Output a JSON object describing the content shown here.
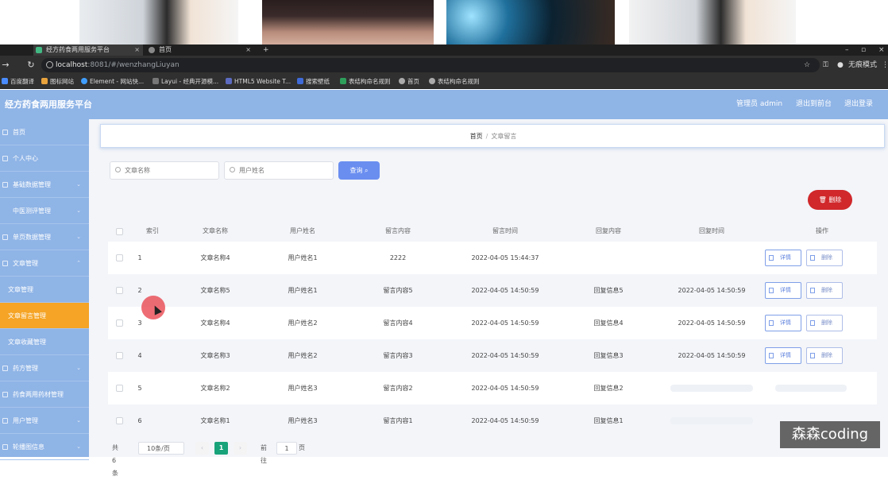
{
  "browser": {
    "tabs": [
      {
        "title": "经方药食两用服务平台",
        "active": true
      },
      {
        "title": "首页",
        "active": false
      }
    ],
    "url_host": "localhost",
    "url_rest": ":8081/#/wenzhangLiuyan",
    "profile_label": "无痕模式",
    "bookmarks": [
      "百度翻译",
      "图标网站",
      "Element - 网站快...",
      "Layui - 经典开源模...",
      "HTML5 Website T...",
      "搜索壁纸",
      "表结构命名规则",
      "首页",
      "表结构命名规则"
    ]
  },
  "header": {
    "title": "经方药食两用服务平台",
    "user_label": "管理员 admin",
    "back_label": "退出到前台",
    "logout_label": "退出登录"
  },
  "sidebar": {
    "items": [
      {
        "label": "首页"
      },
      {
        "label": "个人中心"
      },
      {
        "label": "基础数据管理"
      },
      {
        "label": "中医测评管理"
      },
      {
        "label": "单页数据管理"
      },
      {
        "label": "文章管理"
      },
      {
        "label": "文章管理"
      },
      {
        "label": "文章留言管理"
      },
      {
        "label": "文章收藏管理"
      },
      {
        "label": "药方管理"
      },
      {
        "label": "药食两用药材管理"
      },
      {
        "label": "用户管理"
      },
      {
        "label": "轮播图信息"
      }
    ]
  },
  "breadcrumb": {
    "home": "首页",
    "sep": "/",
    "current": "文章留言"
  },
  "search": {
    "title_placeholder": "文章名称",
    "user_placeholder": "用户姓名",
    "query_label": "查询"
  },
  "toolbar": {
    "delete_label": "删除"
  },
  "table": {
    "columns": [
      "索引",
      "文章名称",
      "用户姓名",
      "留言内容",
      "留言时间",
      "回复内容",
      "回复时间",
      "操作"
    ],
    "detail_label": "详情",
    "delete_label": "删除",
    "rows": [
      {
        "index": "1",
        "title": "文章名称4",
        "user": "用户姓名1",
        "content": "2222",
        "time": "2022-04-05 15:44:37",
        "reply": "",
        "reply_time": ""
      },
      {
        "index": "2",
        "title": "文章名称5",
        "user": "用户姓名1",
        "content": "留言内容5",
        "time": "2022-04-05 14:50:59",
        "reply": "回复信息5",
        "reply_time": "2022-04-05 14:50:59"
      },
      {
        "index": "3",
        "title": "文章名称4",
        "user": "用户姓名2",
        "content": "留言内容4",
        "time": "2022-04-05 14:50:59",
        "reply": "回复信息4",
        "reply_time": "2022-04-05 14:50:59"
      },
      {
        "index": "4",
        "title": "文章名称3",
        "user": "用户姓名2",
        "content": "留言内容3",
        "time": "2022-04-05 14:50:59",
        "reply": "回复信息3",
        "reply_time": "2022-04-05 14:50:59"
      },
      {
        "index": "5",
        "title": "文章名称2",
        "user": "用户姓名3",
        "content": "留言内容2",
        "time": "2022-04-05 14:50:59",
        "reply": "回复信息2",
        "reply_time": ""
      },
      {
        "index": "6",
        "title": "文章名称1",
        "user": "用户姓名3",
        "content": "留言内容1",
        "time": "2022-04-05 14:50:59",
        "reply": "回复信息1",
        "reply_time": ""
      }
    ]
  },
  "pager": {
    "total_label": "共 6 条",
    "page_size": "10条/页",
    "prev": "‹",
    "current": "1",
    "next": "›",
    "goto_label": "前往",
    "goto_value": "1",
    "page_unit": "页"
  },
  "watermark": "森森coding",
  "colors": {
    "header_bg": "#8fb4e6",
    "sidebar_active": "#f5a425",
    "query_btn": "#6a8ef0",
    "delete_btn": "#d0282b",
    "pager_current": "#19a37a"
  }
}
